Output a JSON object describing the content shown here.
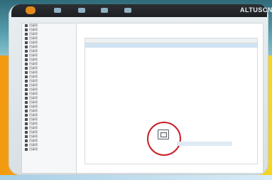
{
  "brand": {
    "name": "ALTUSCN"
  },
  "header": {
    "icons": [
      "app-icon-1",
      "app-icon-2",
      "app-icon-3",
      "app-icon-4"
    ]
  },
  "sidebar": {
    "items": [
      {
        "label": "目录项"
      },
      {
        "label": "目录项"
      },
      {
        "label": "目录项"
      },
      {
        "label": "目录项"
      },
      {
        "label": "目录项"
      },
      {
        "label": "目录项"
      },
      {
        "label": "目录项"
      },
      {
        "label": "目录项"
      },
      {
        "label": "目录项"
      },
      {
        "label": "目录项"
      },
      {
        "label": "目录项"
      },
      {
        "label": "目录项"
      },
      {
        "label": "目录项"
      },
      {
        "label": "目录项"
      },
      {
        "label": "目录项"
      },
      {
        "label": "目录项"
      },
      {
        "label": "目录项"
      },
      {
        "label": "目录项"
      },
      {
        "label": "目录项"
      },
      {
        "label": "目录项"
      },
      {
        "label": "目录项"
      },
      {
        "label": "目录项"
      },
      {
        "label": "目录项"
      },
      {
        "label": "目录项"
      },
      {
        "label": "目录项"
      },
      {
        "label": "目录项"
      },
      {
        "label": "目录项"
      },
      {
        "label": "目录项"
      },
      {
        "label": "目录项"
      },
      {
        "label": "目录项"
      }
    ]
  },
  "main": {
    "breadcrumb": "",
    "table": {
      "headers": [
        "",
        "",
        ""
      ],
      "rows": [
        [
          "",
          "",
          ""
        ]
      ]
    },
    "empty": {
      "message": "",
      "link": ""
    },
    "footer_note": ""
  },
  "colors": {
    "accent_orange": "#f39a10",
    "highlight_red": "#c8202a",
    "selection_blue": "#cfe3f3"
  }
}
